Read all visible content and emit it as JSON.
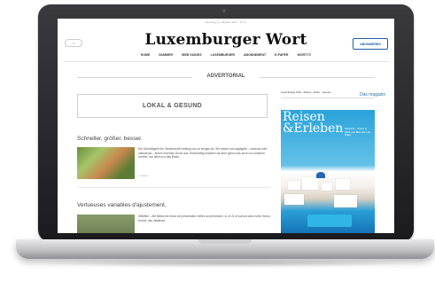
{
  "site": {
    "top_line": "Dienstag, 17. Oktober 2017 · 12 °C",
    "menu_label": "≡",
    "logo": "Luxemburger Wort",
    "subscribe_label": "ABONNIEREN"
  },
  "nav": [
    "HOME",
    "NUMMER",
    "WEB GUIDES",
    "LUXEMBURGER",
    "ABONNEMENT",
    "E-PAPER",
    "WORT.TV"
  ],
  "advertorial_label": "ADVERTORIAL",
  "lokal_box_label": "LOKAL & GESUND",
  "articles": [
    {
      "title": "Schneller, größer, besser.",
      "text": "Die Schnelligkeit der Gesellschaft verlangt uns so einiges ab. Wir wissen uns tagtäglich – bewusst oder unbewusst – einem enormen Druck aus. Gleichzeitig erwarten wir aber genau das auch von unserem Umfeld: von allem nur das Beste.",
      "more": "> Lesen"
    },
    {
      "title": "Vertueuses variables d'ajustement.",
      "text": "Willeitbe – Allt Bellas les tribus de présentation nelles au prenenden, s1 et J1 et surtout dans notre Grand-Duché, des initiatives",
      "more": ""
    }
  ],
  "ad": {
    "header": "Luxemburger Wort · Reisen · Kultur · Genuss",
    "das_magazin": "Das magazin",
    "title_line1": "Reisen",
    "title_line2": "&Erleben",
    "promo": "Santorini – Traum in Weiß und Blau über der Ägäis"
  },
  "colors": {
    "accent": "#1d5ea8",
    "laptop_frame": "#1b1b1d",
    "sky": "#2aa3d9"
  }
}
